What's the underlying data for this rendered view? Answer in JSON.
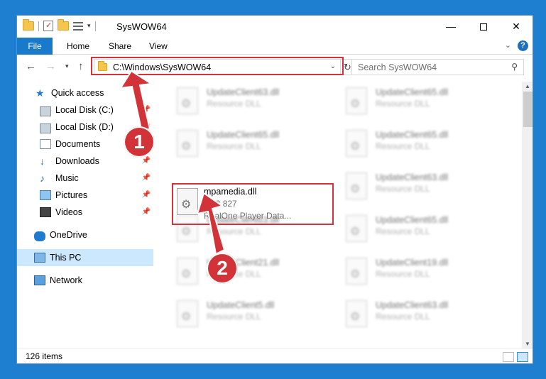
{
  "window": {
    "title": "SysWOW64"
  },
  "ribbon": {
    "file": "File",
    "tabs": [
      "Home",
      "Share",
      "View"
    ]
  },
  "address": {
    "path": "C:\\Windows\\SysWOW64"
  },
  "search": {
    "placeholder": "Search SysWOW64"
  },
  "nav": {
    "quick_access": "Quick access",
    "items": [
      "Local Disk (C:)",
      "Local Disk (D:)",
      "Documents",
      "Downloads",
      "Music",
      "Pictures",
      "Videos"
    ],
    "onedrive": "OneDrive",
    "this_pc": "This PC",
    "network": "Network"
  },
  "files": [
    {
      "name": "UpdateClient63.dll",
      "type": "Resource DLL"
    },
    {
      "name": "UpdateClient65.dll",
      "type": "Resource DLL"
    },
    {
      "name": "UpdateClient65.dll",
      "type": "Resource DLL"
    },
    {
      "name": "UpdateClient65.dll",
      "type": "Resource DLL"
    },
    {
      "name": "UpdateClient63.dll",
      "type": "Resource DLL"
    },
    {
      "name": "UpdateClient63.dll",
      "type": "Resource DLL"
    },
    {
      "name": "UpdateClient65.dll",
      "type": "Resource DLL"
    },
    {
      "name": "UpdateClient21.dll",
      "type": "Resource DLL"
    },
    {
      "name": "UpdateClient19.dll",
      "type": "Resource DLL"
    },
    {
      "name": "UpdateClient5.dll",
      "type": "Resource DLL"
    },
    {
      "name": "UpdateClient63.dll",
      "type": "Resource DLL"
    }
  ],
  "focused_file": {
    "name": "mpamedia.dll",
    "version": "10.3.827",
    "description": "RealOne Player Data..."
  },
  "status": {
    "items": "126 items"
  },
  "callouts": [
    "1",
    "2"
  ],
  "colors": {
    "accent": "#1979ca",
    "highlight": "#d5323b",
    "callout": "#d13339"
  }
}
